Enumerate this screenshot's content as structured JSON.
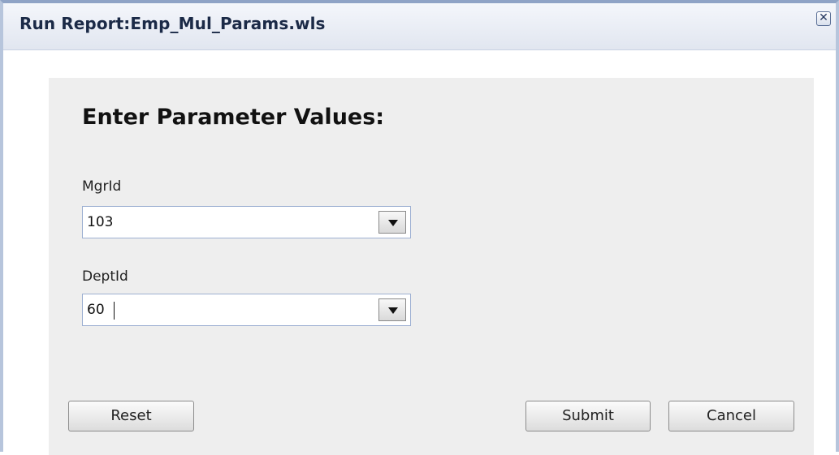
{
  "window": {
    "title": "Run Report:Emp_Mul_Params.wls",
    "close_glyph": "✕"
  },
  "form": {
    "heading": "Enter Parameter Values:",
    "fields": [
      {
        "label": "MgrId",
        "value": "103"
      },
      {
        "label": "DeptId",
        "value": "60"
      }
    ]
  },
  "buttons": {
    "reset": "Reset",
    "submit": "Submit",
    "cancel": "Cancel"
  },
  "colors": {
    "panel_bg": "#eeeeee",
    "title_text": "#1b2a47",
    "input_border": "#9db0d2"
  },
  "icons": [
    "close-icon",
    "dropdown-arrow-icon"
  ]
}
